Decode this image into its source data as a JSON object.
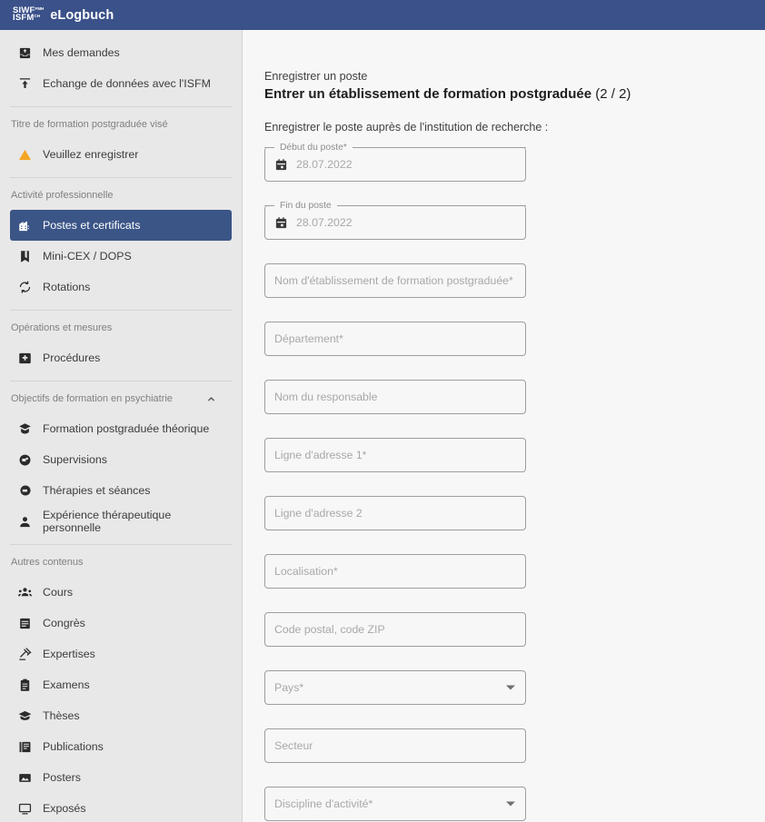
{
  "header": {
    "logo": {
      "line1": "SIWF",
      "line1_sup": "FMH",
      "line2": "ISFM",
      "line2_sup": "CH",
      "icon": "siwf-isfm-logo"
    },
    "app_title": "eLogbuch",
    "bar_color": "#3a5189"
  },
  "sidebar": {
    "background": "#e8e8e8",
    "active_color": "#3b5587",
    "warning_color": "#f5a623",
    "top_items": [
      {
        "label": "Mes demandes",
        "icon": "inbox-tray-icon",
        "name": "mes-demandes"
      },
      {
        "label": "Echange de données avec l'ISFM",
        "icon": "upload-arrow-icon",
        "name": "echange-donnees-isfm"
      }
    ],
    "groups": [
      {
        "label": "Titre de formation postgraduée visé",
        "name": "titre-formation-postgraduee-vise",
        "collapsible": false,
        "items": [
          {
            "label": "Veuillez enregistrer",
            "icon": "warning-triangle-icon",
            "name": "veuillez-enregistrer",
            "warning": true
          }
        ]
      },
      {
        "label": "Activité professionnelle",
        "name": "activite-professionnelle",
        "collapsible": false,
        "items": [
          {
            "label": "Postes et certificats",
            "icon": "hospital-building-icon",
            "name": "postes-et-certificats",
            "active": true
          },
          {
            "label": "Mini-CEX / DOPS",
            "icon": "book-icon",
            "name": "mini-cex-dops"
          },
          {
            "label": "Rotations",
            "icon": "rotate-icon",
            "name": "rotations"
          }
        ]
      },
      {
        "label": "Opérations et mesures",
        "name": "operations-et-mesures",
        "collapsible": false,
        "items": [
          {
            "label": "Procédures",
            "icon": "medical-cross-icon",
            "name": "procedures"
          }
        ]
      },
      {
        "label": "Objectifs de formation en psychiatrie",
        "name": "objectifs-formation-psychiatrie",
        "collapsible": true,
        "chevron": "chevron-up-icon",
        "items": [
          {
            "label": "Formation postgraduée théorique",
            "icon": "graduation-cap-icon",
            "name": "formation-postgraduee-theorique"
          },
          {
            "label": "Supervisions",
            "icon": "supervision-head-icon",
            "name": "supervisions"
          },
          {
            "label": "Thérapies et séances",
            "icon": "therapy-head-icon",
            "name": "therapies-et-seances"
          },
          {
            "label": "Expérience thérapeutique personnelle",
            "icon": "person-icon",
            "name": "experience-therapeutique-personnelle"
          }
        ]
      },
      {
        "label": "Autres contenus",
        "name": "autres-contenus",
        "collapsible": false,
        "items": [
          {
            "label": "Cours",
            "icon": "group-people-icon",
            "name": "cours"
          },
          {
            "label": "Congrès",
            "icon": "calendar-note-icon",
            "name": "congres"
          },
          {
            "label": "Expertises",
            "icon": "gavel-icon",
            "name": "expertises"
          },
          {
            "label": "Examens",
            "icon": "clipboard-icon",
            "name": "examens"
          },
          {
            "label": "Thèses",
            "icon": "mortarboard-icon",
            "name": "theses"
          },
          {
            "label": "Publications",
            "icon": "article-icon",
            "name": "publications"
          },
          {
            "label": "Posters",
            "icon": "image-frame-icon",
            "name": "posters"
          },
          {
            "label": "Exposés",
            "icon": "presentation-screen-icon",
            "name": "exposes"
          }
        ]
      }
    ]
  },
  "main": {
    "breadcrumb": "Enregistrer un poste",
    "title": "Entrer un établissement de formation postgraduée",
    "step": "(2 / 2)",
    "intro": "Enregistrer le poste auprès de l'institution de recherche :",
    "fields": [
      {
        "name": "debut-du-poste",
        "kind": "date",
        "label": "Début du poste*",
        "placeholder": "28.07.2022",
        "value": "",
        "icon": "calendar-icon"
      },
      {
        "name": "fin-du-poste",
        "kind": "date",
        "label": "Fin du poste",
        "placeholder": "28.07.2022",
        "value": "",
        "icon": "calendar-icon"
      },
      {
        "name": "nom-etablissement-formation-postgraduee",
        "kind": "text",
        "label": "",
        "placeholder": "Nom d'établissement de formation postgraduée*",
        "value": ""
      },
      {
        "name": "departement",
        "kind": "text",
        "label": "",
        "placeholder": "Département*",
        "value": ""
      },
      {
        "name": "nom-du-responsable",
        "kind": "text",
        "label": "",
        "placeholder": "Nom du responsable",
        "value": ""
      },
      {
        "name": "ligne-adresse-1",
        "kind": "text",
        "label": "",
        "placeholder": "Ligne d'adresse 1*",
        "value": ""
      },
      {
        "name": "ligne-adresse-2",
        "kind": "text",
        "label": "",
        "placeholder": "Ligne d'adresse 2",
        "value": ""
      },
      {
        "name": "localisation",
        "kind": "text",
        "label": "",
        "placeholder": "Localisation*",
        "value": ""
      },
      {
        "name": "code-postal-zip",
        "kind": "text",
        "label": "",
        "placeholder": "Code postal, code ZIP",
        "value": ""
      },
      {
        "name": "pays",
        "kind": "select",
        "label": "",
        "placeholder": "Pays*",
        "value": "",
        "icon": "caret-down-icon"
      },
      {
        "name": "secteur",
        "kind": "text",
        "label": "",
        "placeholder": "Secteur",
        "value": ""
      },
      {
        "name": "discipline-activite",
        "kind": "select",
        "label": "",
        "placeholder": "Discipline d'activité*",
        "value": "",
        "icon": "caret-down-icon"
      }
    ]
  }
}
